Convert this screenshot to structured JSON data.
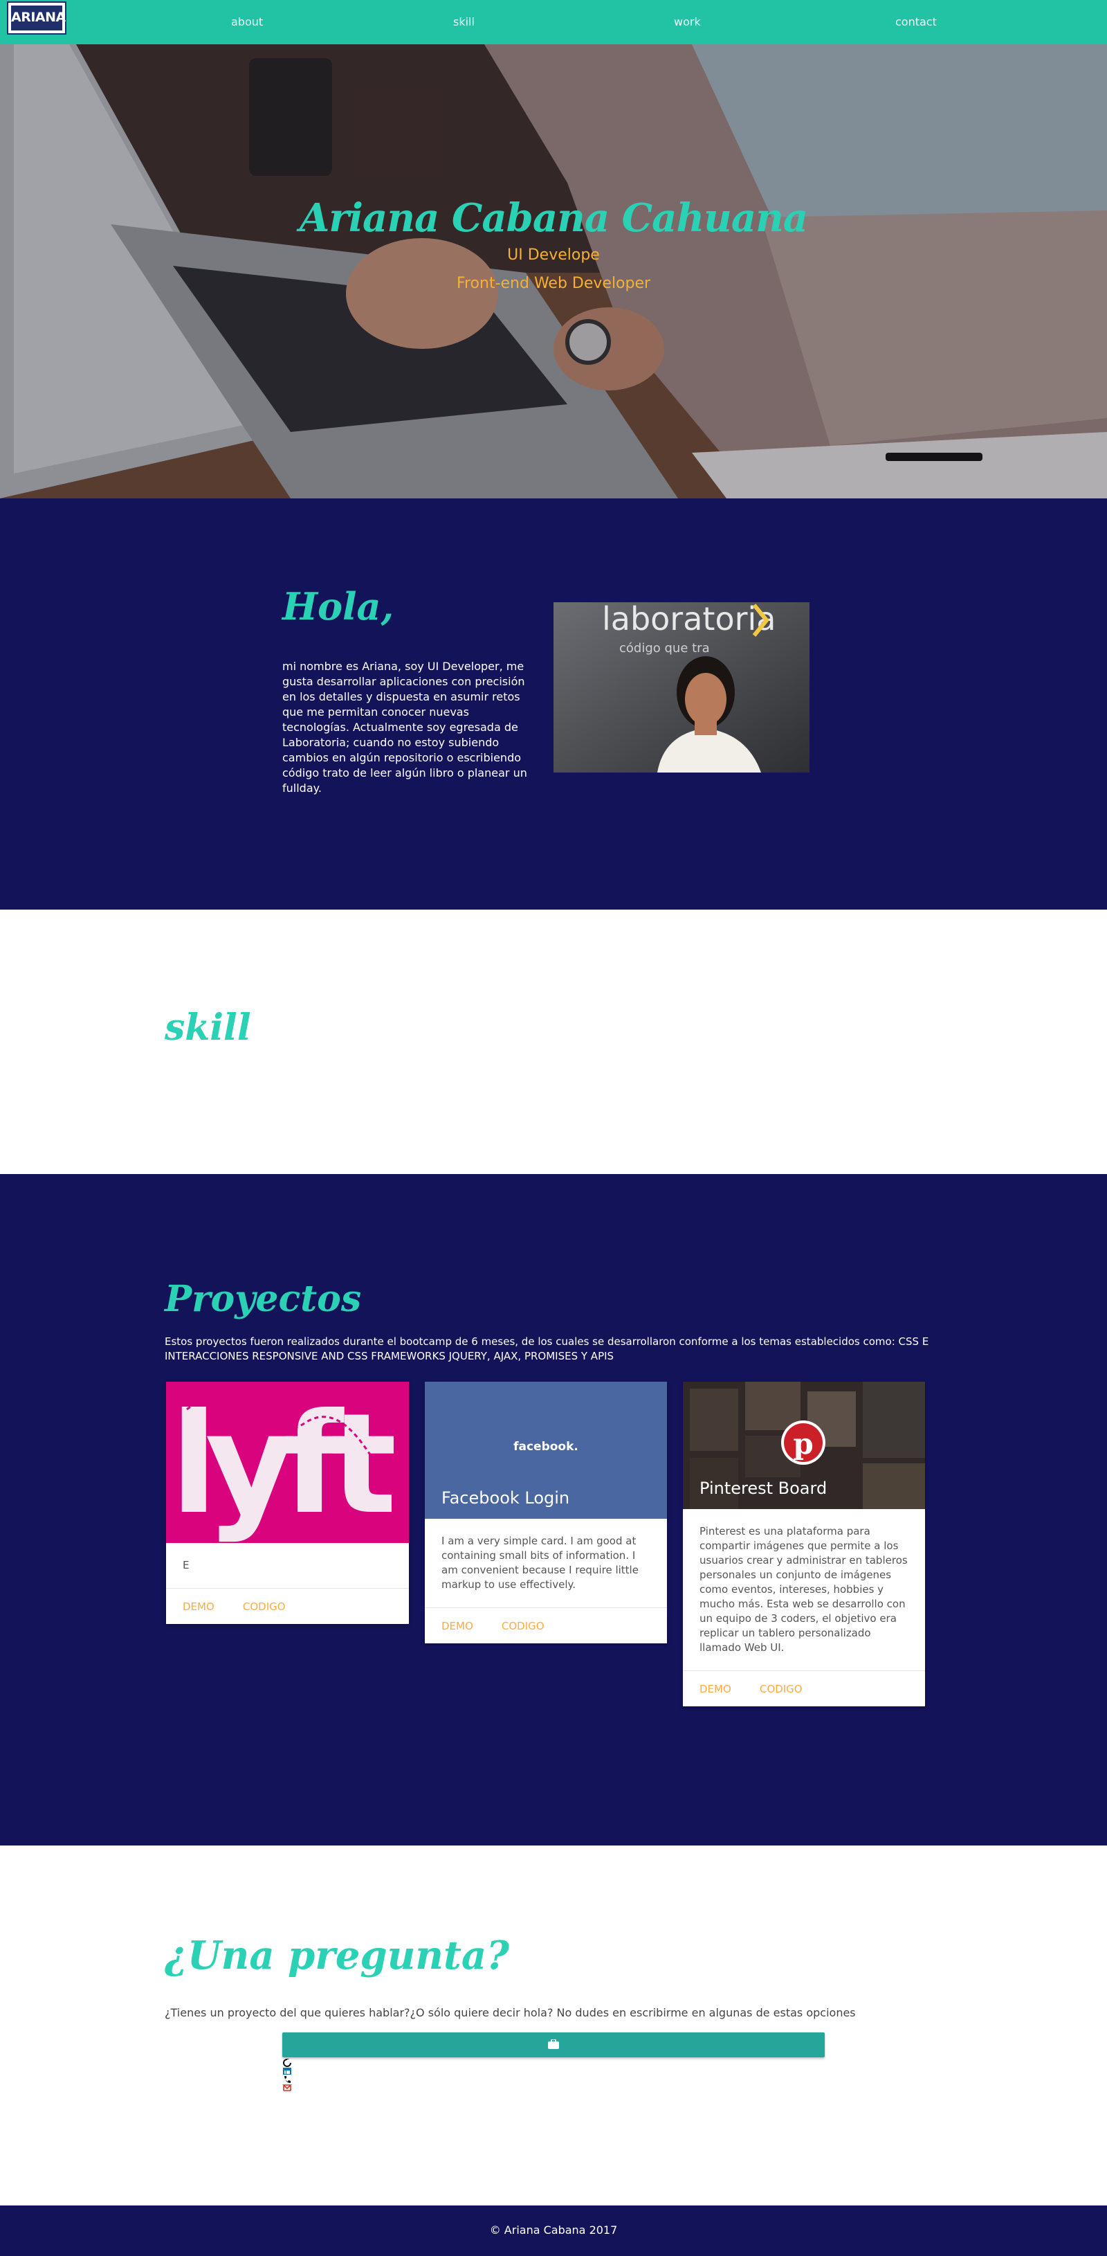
{
  "nav": {
    "logo_text": "ARIANA",
    "links": [
      "about",
      "skill",
      "work",
      "contact"
    ]
  },
  "hero": {
    "title": "Ariana Cabana Cahuana",
    "subtitle1": "UI Develope",
    "subtitle2": "Front-end Web Developer"
  },
  "about": {
    "heading": "Hola,",
    "text": "mi nombre es Ariana, soy UI Developer, me gusta desarrollar aplicaciones con precisión en los detalles y dispuesta en asumir retos que me permitan conocer nuevas tecnologías. Actualmente soy egresada de Laboratoria; cuando no estoy subiendo cambios en algún repositorio o escribiendo código trato de leer algún libro o planear un fullday.",
    "photo_sign": "laboratoria",
    "photo_sub": "código que tra"
  },
  "skill": {
    "heading": "skill"
  },
  "projects": {
    "heading": "Proyectos",
    "description": "Estos proyectos fueron realizados durante el bootcamp de 6 meses, de los cuales se desarrollaron conforme a los temas establecidos como: CSS E INTERACCIONES RESPONSIVE AND CSS FRAMEWORKS JQUERY, AJAX, PROMISES Y APIS",
    "cards": [
      {
        "title": "",
        "logo": "lyft",
        "text": "E",
        "demo": "DEMO",
        "code": "CODIGO"
      },
      {
        "title": "Facebook Login",
        "logo": "facebook.",
        "text": "I am a very simple card. I am good at containing small bits of information. I am convenient because I require little markup to use effectively.",
        "demo": "DEMO",
        "code": "CODIGO"
      },
      {
        "title": "Pinterest Board",
        "logo": "pinterest",
        "text": "Pinterest es una plataforma para compartir imágenes que permite a los usuarios crear y administrar en tableros personales un conjunto de imágenes como eventos, intereses, hobbies y mucho más. Esta web se desarrollo con un equipo de 3 coders, el objetivo era replicar un tablero personalizado llamado Web UI.",
        "demo": "DEMO",
        "code": "CODIGO"
      }
    ]
  },
  "contact": {
    "heading": "¿Una pregunta?",
    "description": "¿Tienes un proyecto del que quieres hablar?¿O sólo quiere decir hola? No dudes en escribirme en algunas de estas opciones",
    "icons": [
      "briefcase-icon",
      "github-icon",
      "linkedin-icon",
      "phone-icon",
      "email-icon"
    ]
  },
  "footer": {
    "text": "© Ariana Cabana 2017"
  },
  "colors": {
    "teal": "#22c3a5",
    "navy": "#13135a",
    "orange": "#f6b135",
    "button": "#26a69a"
  }
}
